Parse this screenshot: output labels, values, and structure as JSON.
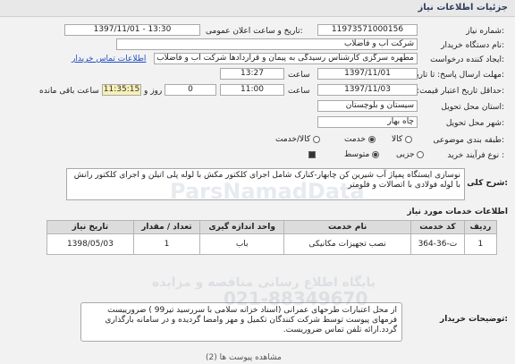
{
  "header": {
    "title": "جزئیات اطلاعات نیاز"
  },
  "form": {
    "need_number": {
      "label": "شماره نیاز:",
      "value": "11973571000156"
    },
    "public_date": {
      "label": "تاریخ و ساعت اعلان عمومی:",
      "value": "1397/11/01 - 13:30"
    },
    "buyer_org": {
      "label": "نام دستگاه خریدار:",
      "value": "شرکت آب و فاضلاب"
    },
    "requester": {
      "label": "ایجاد کننده درخواست:",
      "value": "مطهره سرگزی کارشناس رسیدگی به پیمان و قراردادها شرکت آب و فاضلاب",
      "contact_link": "اطلاعات تماس خریدار"
    },
    "reply_deadline": {
      "label": "مهلت ارسال پاسخ: تا تاریخ:",
      "date": "1397/11/01",
      "time_label": "ساعت",
      "time": "13:27"
    },
    "validity_deadline": {
      "label": "حداقل تاریخ اعتبار قیمت: تا تاریخ:",
      "date": "1397/11/03",
      "time_label": "ساعت",
      "time": "11:00",
      "days": "0",
      "days_label": "روز و",
      "remaining": "11:35:15",
      "remaining_label": "ساعت باقی مانده"
    },
    "province": {
      "label": "استان محل تحویل:",
      "value": "سیستان و بلوچستان"
    },
    "city": {
      "label": "شهر محل تحویل:",
      "value": "چاه بهار"
    },
    "category": {
      "label": "طبقه بندی موضوعی:",
      "options": [
        "کالا",
        "خدمت",
        "کالا/خدمت"
      ],
      "selected": "خدمت"
    },
    "process": {
      "label": "نوع فرآیند خرید :",
      "options": [
        "جزیی",
        "متوسط"
      ],
      "selected": "متوسط"
    }
  },
  "description": {
    "label": "شرح کلی نیاز:",
    "text": "نوسازی ایستگاه پمپاژ آب شیرین کن چابهار-کنارک شامل اجرای کلکتور مکش با لوله پلی اتیلن و اجرای کلکتور رانش با لوله فولادی با اتصالات و فلومتر"
  },
  "services": {
    "section_title": "اطلاعات خدمات مورد نیاز",
    "columns": [
      "ردیف",
      "کد خدمت",
      "نام خدمت",
      "واحد اندازه گیری",
      "تعداد / مقدار",
      "تاریخ نیاز"
    ],
    "rows": [
      {
        "row": "1",
        "code": "ت-36-364",
        "name": "نصب تجهیزات مکانیکی",
        "unit": "باب",
        "qty": "1",
        "date": "1398/05/03"
      }
    ]
  },
  "buyer_notes": {
    "label": "توضیحات خریدار:",
    "text": "از محل اعتبارات طرحهای عمرانی (اسناد خزانه سلامی با سررسید تیر99 ) ضرورییست فرمهای پیوست توسط شرکت کنندگان تکمیل و مهر وامضا گردیده و در سامانه بارگذاری گردد.ارائه تلفن تماس ضروریست."
  },
  "footer": {
    "text": "مشاهده پیوست ها (2)"
  },
  "watermark": {
    "brand": "ParsNamadData",
    "phone": "021-88349670",
    "line": "پایگاه اطلاع رسانی مناقصه و مزایده"
  }
}
